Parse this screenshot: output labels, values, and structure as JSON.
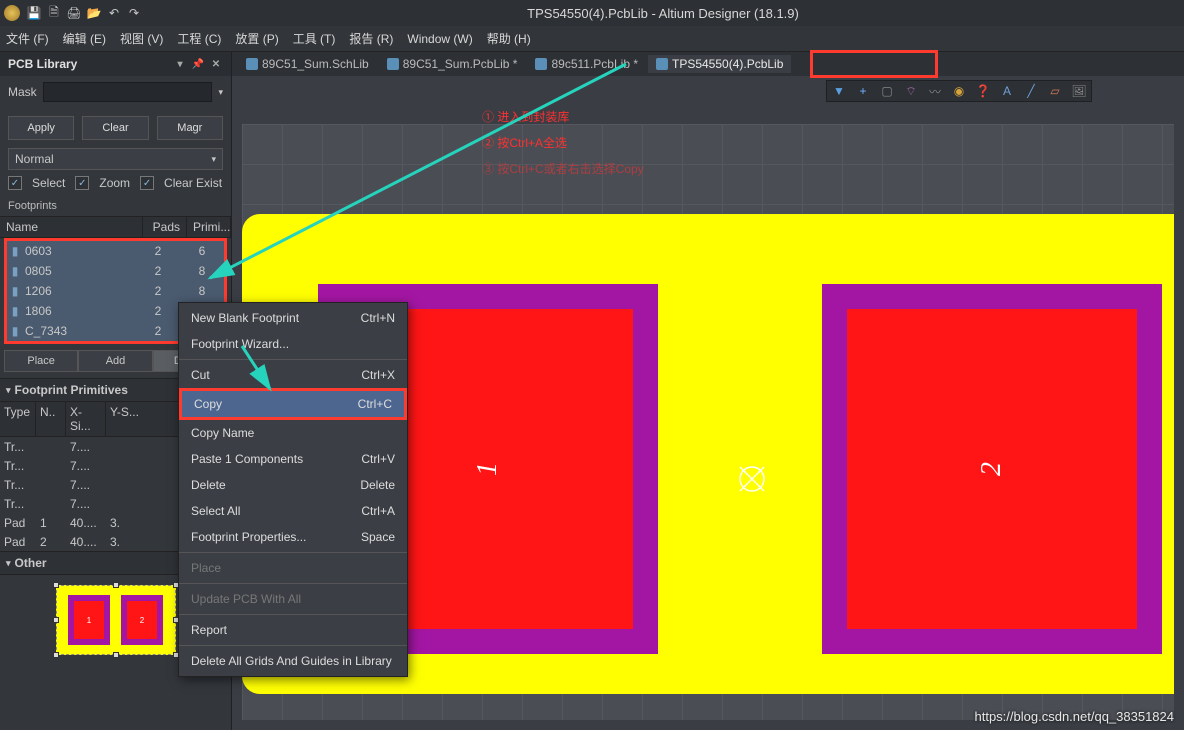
{
  "app": {
    "title": "TPS54550(4).PcbLib - Altium Designer (18.1.9)"
  },
  "menu": {
    "file": "文件 (F)",
    "edit": "编辑 (E)",
    "view": "视图 (V)",
    "project": "工程 (C)",
    "place": "放置 (P)",
    "tools": "工具 (T)",
    "report": "报告 (R)",
    "window": "Window (W)",
    "help": "帮助 (H)"
  },
  "panel": {
    "title": "PCB Library",
    "mask_label": "Mask",
    "apply": "Apply",
    "clear": "Clear",
    "magnify": "Magr",
    "mode": "Normal",
    "chk_select": "Select",
    "chk_zoom": "Zoom",
    "chk_clearexist": "Clear Exist",
    "footprints_label": "Footprints",
    "col_name": "Name",
    "col_pads": "Pads",
    "col_prim": "Primi...",
    "footprints": [
      {
        "name": "0603",
        "pads": "2",
        "prim": "6"
      },
      {
        "name": "0805",
        "pads": "2",
        "prim": "8"
      },
      {
        "name": "1206",
        "pads": "2",
        "prim": "8"
      },
      {
        "name": "1806",
        "pads": "2",
        "prim": ""
      },
      {
        "name": "C_7343",
        "pads": "2",
        "prim": ""
      }
    ],
    "btn_place": "Place",
    "btn_add": "Add",
    "btn_delete": "Delete",
    "prim_title": "Footprint Primitives",
    "prim_cols": {
      "type": "Type",
      "n": "N..",
      "x": "X-Si...",
      "y": "Y-S..."
    },
    "primitives": [
      {
        "t": "Tr...",
        "n": "",
        "x": "7....",
        "y": ""
      },
      {
        "t": "Tr...",
        "n": "",
        "x": "7....",
        "y": ""
      },
      {
        "t": "Tr...",
        "n": "",
        "x": "7....",
        "y": ""
      },
      {
        "t": "Tr...",
        "n": "",
        "x": "7....",
        "y": ""
      },
      {
        "t": "Pad",
        "n": "1",
        "x": "40....",
        "y": "3."
      },
      {
        "t": "Pad",
        "n": "2",
        "x": "40....",
        "y": "3."
      }
    ],
    "other_title": "Other"
  },
  "tabs": [
    {
      "label": "89C51_Sum.SchLib"
    },
    {
      "label": "89C51_Sum.PcbLib *"
    },
    {
      "label": "89c511.PcbLib *"
    },
    {
      "label": "TPS54550(4).PcbLib"
    }
  ],
  "annotations": {
    "line1": "① 进入到封装库",
    "line2": "② 按Ctrl+A全选",
    "line3": "③ 按Ctrl+C或者右击选择Copy"
  },
  "pads": {
    "p1": "1",
    "p2": "2"
  },
  "context_menu": [
    {
      "label": "New Blank Footprint",
      "shortcut": "Ctrl+N",
      "type": "item"
    },
    {
      "label": "Footprint Wizard...",
      "shortcut": "",
      "type": "item"
    },
    {
      "type": "sep"
    },
    {
      "label": "Cut",
      "shortcut": "Ctrl+X",
      "type": "item"
    },
    {
      "label": "Copy",
      "shortcut": "Ctrl+C",
      "type": "item",
      "hl": true
    },
    {
      "label": "Copy Name",
      "shortcut": "",
      "type": "item"
    },
    {
      "label": "Paste 1 Components",
      "shortcut": "Ctrl+V",
      "type": "item"
    },
    {
      "label": "Delete",
      "shortcut": "Delete",
      "type": "item"
    },
    {
      "label": "Select All",
      "shortcut": "Ctrl+A",
      "type": "item"
    },
    {
      "label": "Footprint Properties...",
      "shortcut": "Space",
      "type": "item"
    },
    {
      "type": "sep"
    },
    {
      "label": "Place",
      "shortcut": "",
      "type": "item",
      "disabled": true
    },
    {
      "type": "sep"
    },
    {
      "label": "Update PCB With All",
      "shortcut": "",
      "type": "item",
      "disabled": true
    },
    {
      "type": "sep"
    },
    {
      "label": "Report",
      "shortcut": "",
      "type": "item"
    },
    {
      "type": "sep"
    },
    {
      "label": "Delete All Grids And Guides in Library",
      "shortcut": "",
      "type": "item"
    }
  ],
  "watermark": "https://blog.csdn.net/qq_38351824"
}
